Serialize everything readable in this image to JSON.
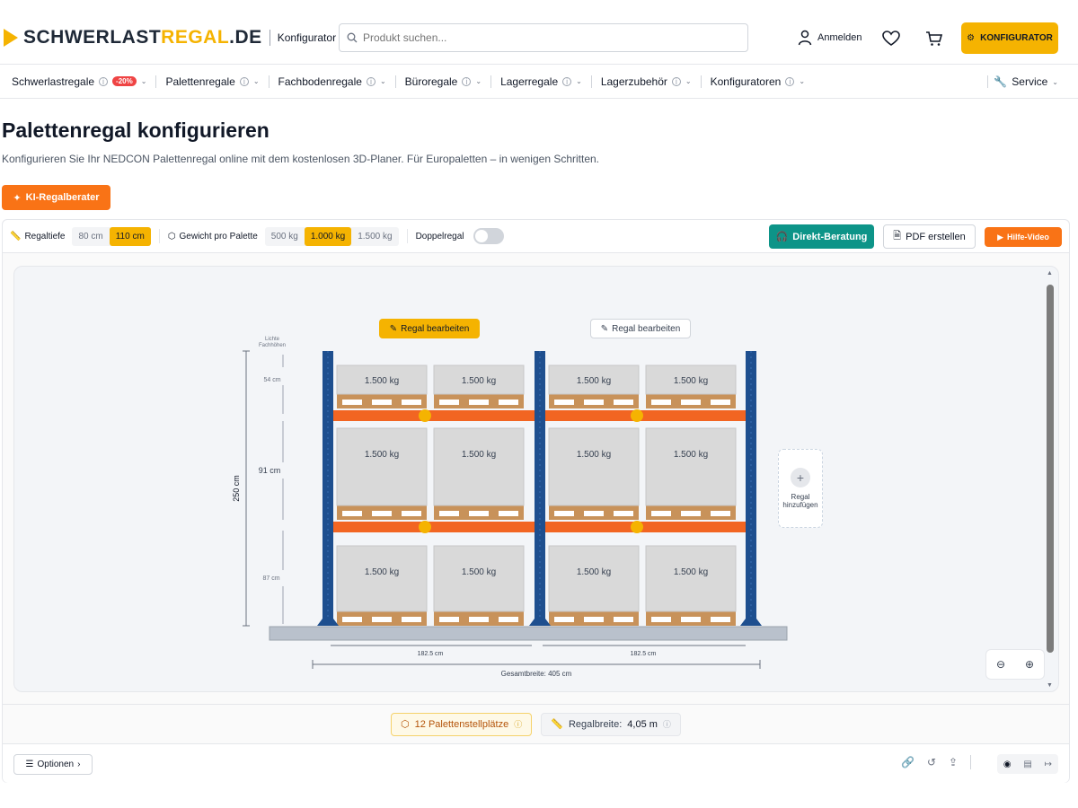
{
  "header": {
    "logo_main": "SCHWERLAST",
    "logo_accent": "REGAL",
    "logo_tld": ".DE",
    "logo_sub": "Konfigurator",
    "search_placeholder": "Produkt suchen...",
    "login_label": "Anmelden",
    "konfigurator_label": "KONFIGURATOR"
  },
  "nav": {
    "items": [
      {
        "label": "Schwerlastregale",
        "badge": "-20%"
      },
      {
        "label": "Palettenregale"
      },
      {
        "label": "Fachbodenregale"
      },
      {
        "label": "Büroregale"
      },
      {
        "label": "Lagerregale"
      },
      {
        "label": "Lagerzubehör"
      },
      {
        "label": "Konfiguratoren"
      }
    ],
    "service_label": "Service"
  },
  "page": {
    "title": "Palettenregal konfigurieren",
    "subtitle": "Konfigurieren Sie Ihr NEDCON Palettenregal online mit dem kostenlosen 3D-Planer. Für Europaletten – in wenigen Schritten.",
    "ki_button": "KI-Regalberater"
  },
  "toolbar": {
    "depth_label": "Regaltiefe",
    "depth_options": [
      "80 cm",
      "110 cm"
    ],
    "depth_selected": "110 cm",
    "weight_label": "Gewicht pro Palette",
    "weight_options": [
      "500 kg",
      "1.000 kg",
      "1.500 kg"
    ],
    "weight_selected": "1.000 kg",
    "double_label": "Doppelregal",
    "double_on": false,
    "direkt_label": "Direkt-Beratung",
    "pdf_label": "PDF erstellen",
    "video_label": "Hilfe-Video"
  },
  "canvas": {
    "edit_label": "Regal bearbeiten",
    "add_label": "Regal hinzufügen",
    "clear_heights_label": "Lichte Fachhöhen",
    "height_total": "250 cm",
    "level_heights": [
      "54 cm",
      "91 cm",
      "87 cm"
    ],
    "bay_widths": [
      "182.5 cm",
      "182.5 cm"
    ],
    "total_width": "Gesamtbreite: 405 cm",
    "pallet_label": "1.500 kg",
    "colors": {
      "upright": "#1e4f8f",
      "beam": "#f26522",
      "pallet": "#c8925a",
      "load": "#d9d9d9"
    }
  },
  "summary": {
    "places": "12 Palettenstellplätze",
    "width_label": "Regalbreite:",
    "width_value": "4,05 m"
  },
  "footer": {
    "options_label": "Optionen"
  }
}
